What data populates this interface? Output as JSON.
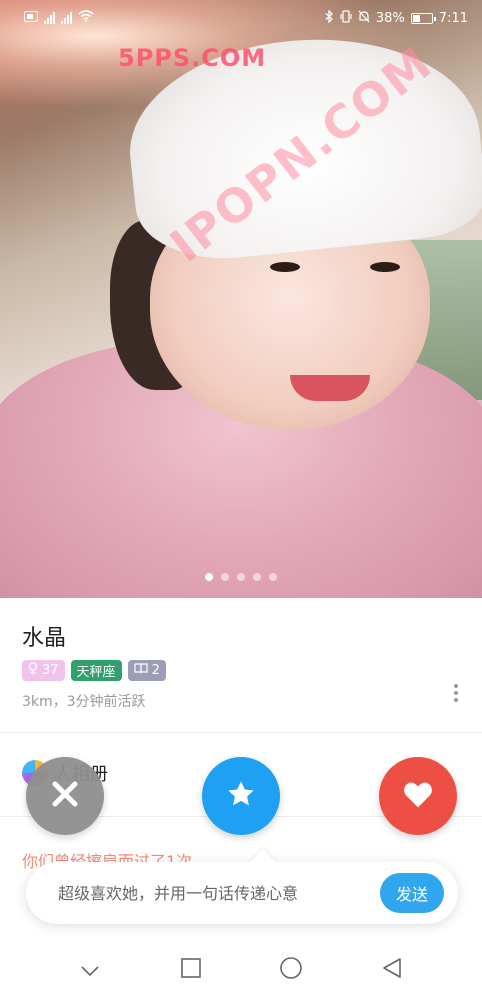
{
  "status_bar": {
    "left_icons": [
      "sim-icon",
      "signal-icon",
      "signal-icon",
      "wifi-icon"
    ],
    "battery_percent": "38%",
    "battery_level": 0.38,
    "time": "7:11"
  },
  "photo": {
    "watermark_small": "5PPS.COM",
    "watermark_large": "IPOPN.COM",
    "pager": {
      "count": 5,
      "active_index": 0
    }
  },
  "profile": {
    "name": "水晶",
    "tags": {
      "age": "37",
      "zodiac": "天秤座",
      "books": "2"
    },
    "meta": "3km，3分钟前活跃"
  },
  "album": {
    "label": "人相册"
  },
  "history_text": "你们曾经擦肩而过了1次",
  "super_like": {
    "placeholder": "超级喜欢她，并用一句话传递心意",
    "send_label": "发送"
  },
  "colors": {
    "dislike": "#8f8f8f",
    "super_like": "#1ea1f2",
    "like": "#ee4f45",
    "zodiac_tag": "#2fa06e",
    "age_tag": "#f1c2ec",
    "books_tag": "#9d9db6",
    "history": "#f08c7a"
  }
}
